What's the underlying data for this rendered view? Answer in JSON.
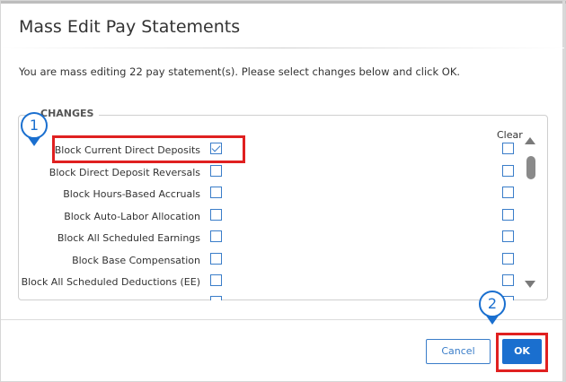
{
  "dialog": {
    "title": "Mass Edit Pay Statements",
    "description": "You are mass editing 22 pay statement(s). Please select changes below and click OK."
  },
  "changes": {
    "legend": "CHANGES",
    "clear_label": "Clear",
    "rows": [
      {
        "label": "Block Current Direct Deposits",
        "checked": true
      },
      {
        "label": "Block Direct Deposit Reversals",
        "checked": false
      },
      {
        "label": "Block Hours-Based Accruals",
        "checked": false
      },
      {
        "label": "Block Auto-Labor Allocation",
        "checked": false
      },
      {
        "label": "Block All Scheduled Earnings",
        "checked": false
      },
      {
        "label": "Block Base Compensation",
        "checked": false
      },
      {
        "label": "Block All Scheduled Deductions (EE)",
        "checked": false
      }
    ]
  },
  "buttons": {
    "cancel": "Cancel",
    "ok": "OK"
  },
  "annotations": {
    "marker1": "1",
    "marker2": "2",
    "marker_color": "#1a6fcf",
    "highlight_color": "#e02020"
  }
}
